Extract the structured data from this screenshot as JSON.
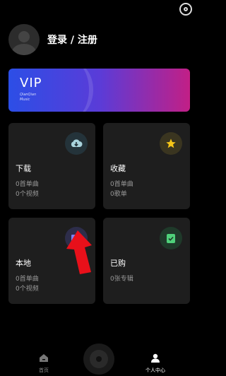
{
  "header": {
    "settings_icon": "settings-target-icon"
  },
  "profile": {
    "login_label": "登录 / 注册",
    "avatar_icon": "default-avatar-icon"
  },
  "vip": {
    "title": "VIP",
    "subtitle_line1": "QianQian",
    "subtitle_line2": "Music"
  },
  "tiles": {
    "download": {
      "title": "下载",
      "songs": "0首单曲",
      "videos": "0个视频",
      "icon": "cloud-download-icon",
      "icon_bg": "#24333a"
    },
    "favorites": {
      "title": "收藏",
      "songs": "0首单曲",
      "playlists": "0歌单",
      "icon": "star-icon",
      "icon_bg": "#3a3520"
    },
    "local": {
      "title": "本地",
      "songs": "0首单曲",
      "videos": "0个视频",
      "icon": "folder-icon",
      "icon_bg": "#2d2d4a"
    },
    "purchased": {
      "title": "已购",
      "albums": "0张专辑",
      "icon": "shopping-bag-icon",
      "icon_bg": "#1f3a2a"
    }
  },
  "bottom_nav": {
    "home_label": "首页",
    "profile_label": "个人中心"
  },
  "colors": {
    "background": "#000000",
    "tile_bg": "#1e1e1e",
    "vip_start": "#2c4ee6",
    "vip_end": "#c21f86",
    "arrow": "#e8101a"
  }
}
